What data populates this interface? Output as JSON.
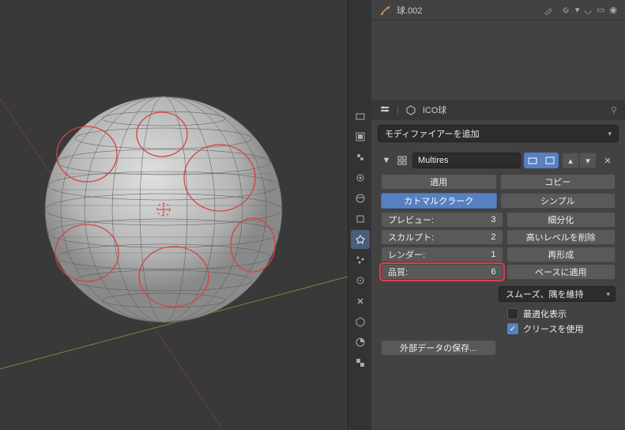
{
  "header": {
    "object_name": "球.002"
  },
  "breadcrumb": {
    "object_type": "ICO球"
  },
  "modifier_dropdown": "モディファイアーを追加",
  "modifier": {
    "name": "Multires",
    "apply": "適用",
    "copy": "コピー",
    "catmull": "カトマルクラーク",
    "simple": "シンプル",
    "preview_label": "プレビュー:",
    "preview_value": "3",
    "sculpt_label": "スカルプト:",
    "sculpt_value": "2",
    "render_label": "レンダー:",
    "render_value": "1",
    "quality_label": "品質:",
    "quality_value": "6",
    "subdivide": "細分化",
    "delete_higher": "高いレベルを削除",
    "reshape": "再形成",
    "apply_base": "ベースに適用",
    "uv_smooth": "スムーズ、隅を維持",
    "optimal_display": "最適化表示",
    "use_crease": "クリースを使用",
    "save_external": "外部データの保存..."
  },
  "chart_data": {
    "type": "table",
    "title": "Multires Modifier Settings",
    "rows": [
      {
        "label": "プレビュー",
        "value": 3
      },
      {
        "label": "スカルプト",
        "value": 2
      },
      {
        "label": "レンダー",
        "value": 1
      },
      {
        "label": "品質",
        "value": 6
      }
    ]
  }
}
